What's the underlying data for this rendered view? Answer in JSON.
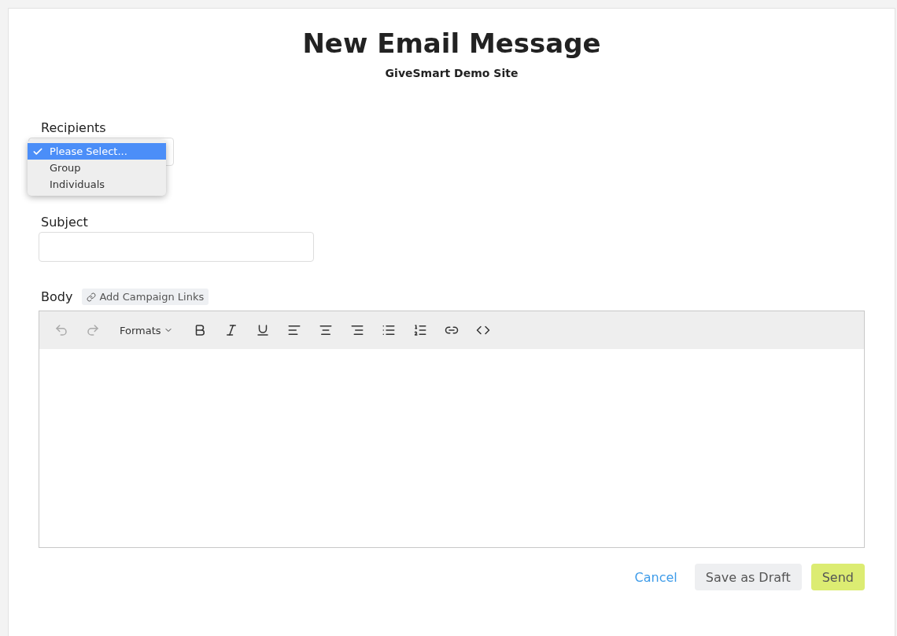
{
  "title": "New Email Message",
  "subtitle": "GiveSmart Demo Site",
  "recipients": {
    "label": "Recipients",
    "open": true,
    "options": [
      {
        "label": "Please Select...",
        "selected": true
      },
      {
        "label": "Group",
        "selected": false
      },
      {
        "label": "Individuals",
        "selected": false
      }
    ]
  },
  "subject": {
    "label": "Subject"
  },
  "body": {
    "label": "Body",
    "campaign_links": "Add Campaign Links",
    "toolbar": [
      {
        "kind": "undo",
        "disabled": true
      },
      {
        "kind": "redo",
        "disabled": true
      },
      {
        "kind": "formats",
        "label": "Formats",
        "disabled": false
      },
      {
        "kind": "bold",
        "disabled": false
      },
      {
        "kind": "italic",
        "disabled": false
      },
      {
        "kind": "underline",
        "disabled": false
      },
      {
        "kind": "align-left",
        "disabled": false
      },
      {
        "kind": "align-center",
        "disabled": false
      },
      {
        "kind": "align-right",
        "disabled": false
      },
      {
        "kind": "bullet-list",
        "disabled": false
      },
      {
        "kind": "numbered-list",
        "disabled": false
      },
      {
        "kind": "link",
        "disabled": false
      },
      {
        "kind": "code",
        "disabled": false
      }
    ]
  },
  "buttons": {
    "cancel": "Cancel",
    "draft": "Save as Draft",
    "send": "Send"
  }
}
